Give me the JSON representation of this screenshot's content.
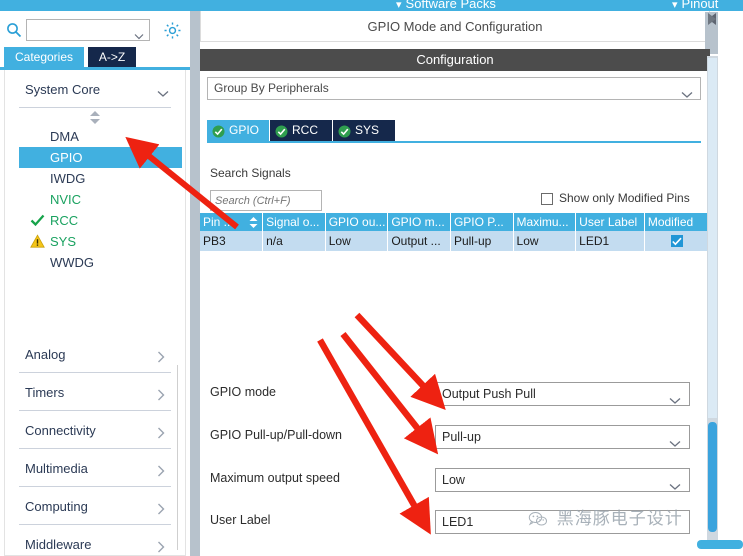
{
  "topbar": {
    "items": [
      {
        "label": "Software Packs",
        "bullet": "▾"
      },
      {
        "label": "Pinout",
        "bullet": "▾"
      }
    ]
  },
  "sidebar": {
    "search": {
      "value": "",
      "placeholder": ""
    },
    "gear_icon": "gear-icon",
    "tabs": [
      {
        "label": "Categories",
        "selected": true
      },
      {
        "label": "A->Z",
        "selected": false
      }
    ],
    "groups": [
      {
        "title": "System Core",
        "expanded": true,
        "items": [
          {
            "label": "DMA",
            "state": "normal",
            "icon": "none"
          },
          {
            "label": "GPIO",
            "state": "selected",
            "icon": "none"
          },
          {
            "label": "IWDG",
            "state": "normal",
            "icon": "none"
          },
          {
            "label": "NVIC",
            "state": "configured",
            "icon": "none"
          },
          {
            "label": "RCC",
            "state": "configured",
            "icon": "check-icon"
          },
          {
            "label": "SYS",
            "state": "configured",
            "icon": "warning-icon"
          },
          {
            "label": "WWDG",
            "state": "normal",
            "icon": "none"
          }
        ]
      },
      {
        "title": "Analog",
        "expanded": false,
        "items": []
      },
      {
        "title": "Timers",
        "expanded": false,
        "items": []
      },
      {
        "title": "Connectivity",
        "expanded": false,
        "items": []
      },
      {
        "title": "Multimedia",
        "expanded": false,
        "items": []
      },
      {
        "title": "Computing",
        "expanded": false,
        "items": []
      },
      {
        "title": "Middleware",
        "expanded": false,
        "items": []
      }
    ]
  },
  "main": {
    "mode_title": "GPIO Mode and Configuration",
    "configuration_band": "Configuration",
    "group_by": {
      "value": "Group By Peripherals"
    },
    "peripheral_tabs": [
      {
        "label": "GPIO",
        "active": true
      },
      {
        "label": "RCC",
        "active": false
      },
      {
        "label": "SYS",
        "active": false
      }
    ],
    "search_signals_label": "Search Signals",
    "signal_search": {
      "value": "",
      "placeholder": "Search (Ctrl+F)"
    },
    "show_only_modified": {
      "label": "Show only Modified Pins",
      "checked": false
    },
    "table": {
      "columns": [
        "Pin ...",
        "Signal o...",
        "GPIO ou...",
        "GPIO m...",
        "GPIO P...",
        "Maximu...",
        "User Label",
        "Modified"
      ],
      "rows": [
        {
          "pin": "PB3",
          "signal": "n/a",
          "gpio_output": "Low",
          "gpio_mode": "Output ...",
          "gpio_pull": "Pull-up",
          "maximum_speed": "Low",
          "user_label": "LED1",
          "modified": true,
          "selected": true
        }
      ]
    },
    "form": [
      {
        "label": "GPIO mode",
        "value": "Output Push Pull",
        "type": "select"
      },
      {
        "label": "GPIO Pull-up/Pull-down",
        "value": "Pull-up",
        "type": "select"
      },
      {
        "label": "Maximum output speed",
        "value": "Low",
        "type": "select"
      },
      {
        "label": "User Label",
        "value": "LED1",
        "type": "text"
      }
    ]
  },
  "watermark": {
    "text": "黑海豚电子设计",
    "icon": "wechat-icon"
  },
  "colors": {
    "accent_blue": "#41b0e0",
    "dark_navy": "#15284b",
    "band_gray": "#4c4c4c",
    "row_selected": "#c3dcf0",
    "green_text": "#1aa260",
    "annotation_red": "#ee2211",
    "splitter": "#b7c2cc"
  }
}
